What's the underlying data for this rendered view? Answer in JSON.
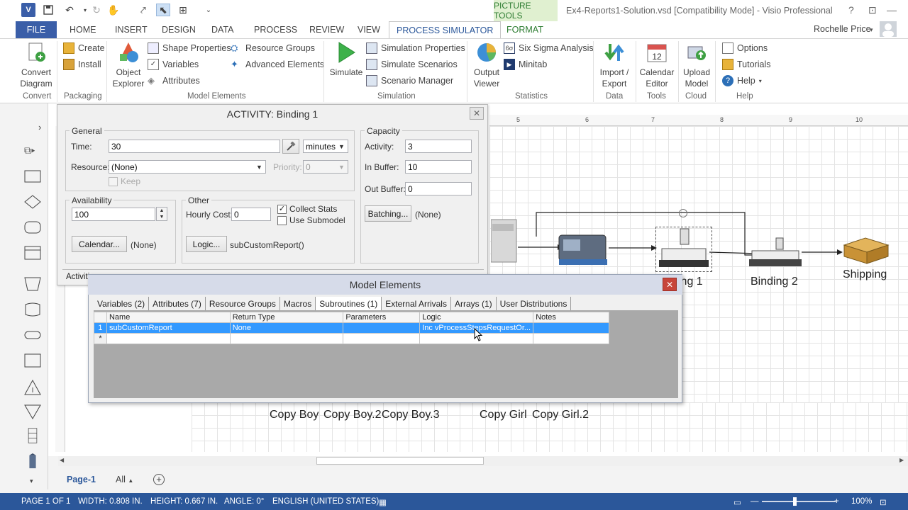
{
  "titlebar": {
    "window_title": "Ex4-Reports1-Solution.vsd  [Compatibility Mode] - Visio Professional",
    "picture_tools": "PICTURE TOOLS",
    "help": "?"
  },
  "tabs": [
    "FILE",
    "HOME",
    "INSERT",
    "DESIGN",
    "DATA",
    "PROCESS",
    "REVIEW",
    "VIEW",
    "PROCESS SIMULATOR",
    "FORMAT"
  ],
  "user": {
    "name": "Rochelle Price"
  },
  "ribbon": {
    "convert": {
      "button": "Convert\nDiagram",
      "label": "Convert"
    },
    "packaging": {
      "create": "Create",
      "install": "Install",
      "label": "Packaging"
    },
    "model_elements": {
      "object_explorer": "Object\nExplorer",
      "shape_properties": "Shape Properties",
      "variables": "Variables",
      "attributes": "Attributes",
      "resource_groups": "Resource Groups",
      "advanced_elements": "Advanced Elements",
      "label": "Model Elements"
    },
    "simulation": {
      "simulate": "Simulate",
      "simulation_properties": "Simulation Properties",
      "simulate_scenarios": "Simulate Scenarios",
      "scenario_manager": "Scenario Manager",
      "label": "Simulation"
    },
    "statistics": {
      "output_viewer": "Output\nViewer",
      "six_sigma": "Six Sigma Analysis",
      "minitab": "Minitab",
      "label": "Statistics"
    },
    "data": {
      "import_export": "Import /\nExport",
      "label": "Data"
    },
    "tools": {
      "calendar_editor": "Calendar\nEditor",
      "label": "Tools"
    },
    "cloud": {
      "upload_model": "Upload\nModel",
      "label": "Cloud"
    },
    "help": {
      "options": "Options",
      "tutorials": "Tutorials",
      "help": "Help",
      "label": "Help"
    }
  },
  "activity": {
    "title": "ACTIVITY: Binding 1",
    "general_label": "General",
    "time_label": "Time:",
    "time_value": "30",
    "time_unit": "minutes",
    "resource_label": "Resource:",
    "resource_value": "(None)",
    "priority_label": "Priority:",
    "priority_value": "0",
    "keep_label": "Keep",
    "capacity_label": "Capacity",
    "activity_label": "Activity:",
    "activity_value": "3",
    "in_buffer_label": "In Buffer:",
    "in_buffer_value": "10",
    "out_buffer_label": "Out Buffer:",
    "out_buffer_value": "0",
    "batching_button": "Batching...",
    "batching_value": "(None)",
    "availability_label": "Availability",
    "availability_value": "100",
    "calendar_button": "Calendar...",
    "calendar_value": "(None)",
    "other_label": "Other",
    "hourly_cost_label": "Hourly Cost:",
    "hourly_cost_value": "0",
    "collect_stats_label": "Collect Stats",
    "use_submodel_label": "Use Submodel",
    "logic_button": "Logic...",
    "logic_value": "subCustomReport()",
    "tab_partial": "Activiti"
  },
  "model_elements": {
    "title": "Model Elements",
    "tabs": [
      "Variables (2)",
      "Attributes (7)",
      "Resource Groups",
      "Macros",
      "Subroutines (1)",
      "External Arrivals",
      "Arrays (1)",
      "User Distributions"
    ],
    "columns": [
      "Name",
      "Return Type",
      "Parameters",
      "Logic",
      "Notes"
    ],
    "rows": [
      {
        "num": "1",
        "name": "subCustomReport",
        "return_type": "None",
        "parameters": "",
        "logic": "Inc vProcessStepsRequestOr...",
        "notes": ""
      }
    ],
    "new_row_marker": "*"
  },
  "diagram": {
    "labels": [
      "Binding 2",
      "Shipping",
      "ing 1",
      "Copy Boy",
      "Copy Boy.2",
      "Copy Boy.3",
      "Copy Girl",
      "Copy Girl.2"
    ],
    "ruler_ticks": [
      "5",
      "6",
      "7",
      "8",
      "9",
      "10"
    ]
  },
  "page_tabs": {
    "page1": "Page-1",
    "all": "All"
  },
  "statusbar": {
    "page": "PAGE 1 OF 1",
    "width": "WIDTH: 0.808 IN.",
    "height": "HEIGHT: 0.667 IN.",
    "angle": "ANGLE: 0°",
    "language": "ENGLISH (UNITED STATES)",
    "zoom": "100%"
  },
  "colors": {
    "accent": "#2b579a",
    "file_tab": "#3a5ea8",
    "selection": "#3399ff",
    "picture_tools": "#2e7d32"
  }
}
